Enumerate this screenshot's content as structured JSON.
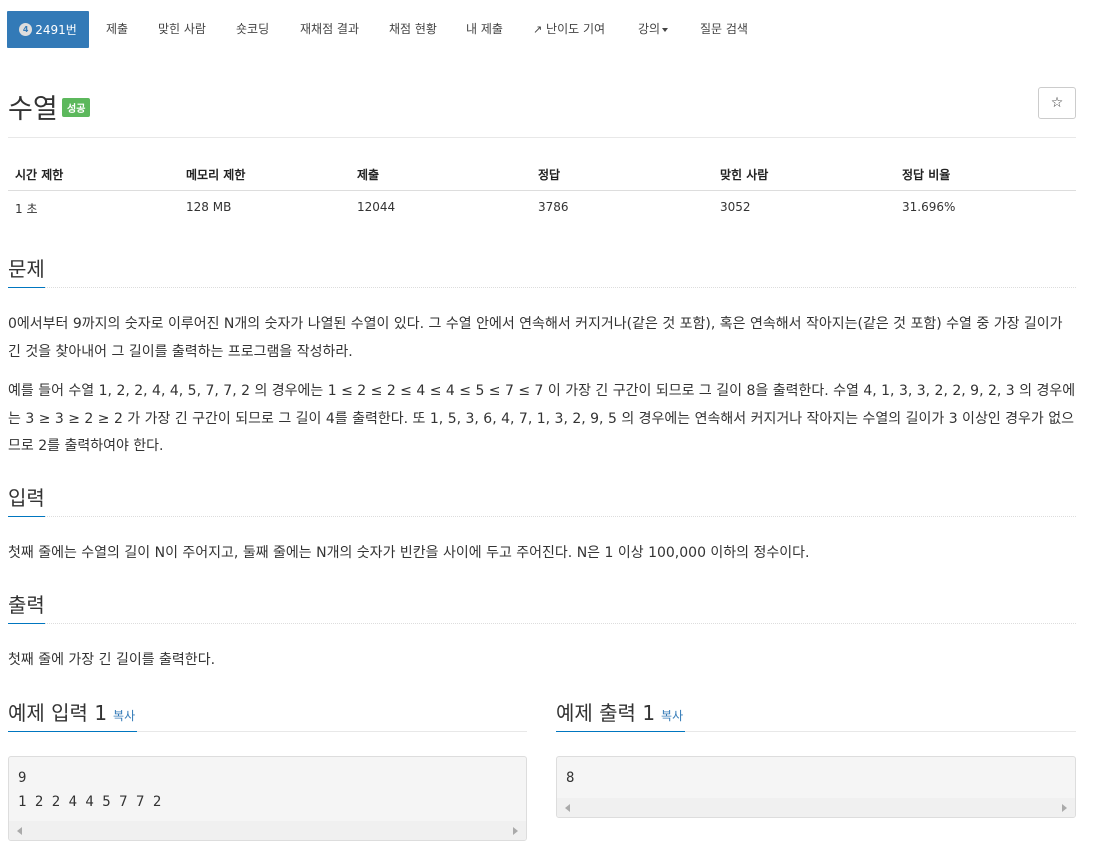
{
  "nav": {
    "active_badge": "4",
    "active_label": "2491번",
    "items": [
      "제출",
      "맞힌 사람",
      "숏코딩",
      "재채점 결과",
      "채점 현황",
      "내 제출",
      "난이도 기여",
      "강의",
      "질문 검색"
    ]
  },
  "problem": {
    "title": "수열",
    "status": "성공",
    "star": "☆"
  },
  "info_table": {
    "headers": [
      "시간 제한",
      "메모리 제한",
      "제출",
      "정답",
      "맞힌 사람",
      "정답 비율"
    ],
    "values": [
      "1 초",
      "128 MB",
      "12044",
      "3786",
      "3052",
      "31.696%"
    ]
  },
  "sections": {
    "problem_head": "문제",
    "problem_p1": "0에서부터 9까지의 숫자로 이루어진 N개의 숫자가 나열된 수열이 있다. 그 수열 안에서 연속해서 커지거나(같은 것 포함), 혹은 연속해서 작아지는(같은 것 포함) 수열 중 가장 길이가 긴 것을 찾아내어 그 길이를 출력하는 프로그램을 작성하라.",
    "problem_p2": "예를 들어 수열 1, 2, 2, 4, 4, 5, 7, 7, 2 의 경우에는 1 ≤ 2 ≤ 2 ≤ 4 ≤ 4 ≤ 5 ≤ 7 ≤ 7 이 가장 긴 구간이 되므로 그 길이 8을 출력한다. 수열 4, 1, 3, 3, 2, 2, 9, 2, 3 의 경우에는 3 ≥ 3 ≥ 2 ≥ 2 가 가장 긴 구간이 되므로 그 길이 4를 출력한다. 또 1, 5, 3, 6, 4, 7, 1, 3, 2, 9, 5 의 경우에는 연속해서 커지거나 작아지는 수열의 길이가 3 이상인 경우가 없으므로 2를 출력하여야 한다.",
    "input_head": "입력",
    "input_p": "첫째 줄에는 수열의 길이 N이 주어지고, 둘째 줄에는 N개의 숫자가 빈칸을 사이에 두고 주어진다. N은 1 이상 100,000 이하의 정수이다.",
    "output_head": "출력",
    "output_p": "첫째 줄에 가장 긴 길이를 출력한다."
  },
  "samples": {
    "input_head": "예제 입력 1",
    "output_head": "예제 출력 1",
    "copy_label": "복사",
    "input_text": "9\n1 2 2 4 4 5 7 7 2",
    "output_text": "8"
  }
}
